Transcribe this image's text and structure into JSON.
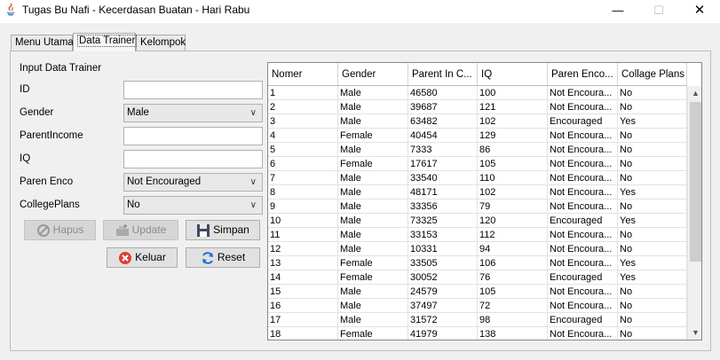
{
  "window": {
    "title": "Tugas Bu Nafi - Kecerdasan Buatan - Hari Rabu",
    "minimize": "—",
    "maximize": "☐",
    "close": "✕"
  },
  "tabs": [
    {
      "label": "Menu Utama"
    },
    {
      "label": "Data Trainer"
    },
    {
      "label": "Kelompok"
    }
  ],
  "form": {
    "heading": "Input Data Trainer",
    "id_label": "ID",
    "id_value": "",
    "gender_label": "Gender",
    "gender_value": "Male",
    "parentincome_label": "ParentIncome",
    "parentincome_value": "",
    "iq_label": "IQ",
    "iq_value": "",
    "parenenco_label": "Paren Enco",
    "parenenco_value": "Not Encouraged",
    "collegeplans_label": "CollegePlans",
    "collegeplans_value": "No"
  },
  "buttons": {
    "hapus": "Hapus",
    "update": "Update",
    "simpan": "Simpan",
    "keluar": "Keluar",
    "reset": "Reset"
  },
  "table": {
    "columns": [
      "Nomer",
      "Gender",
      "Parent In C...",
      "IQ",
      "Paren Enco...",
      "Collage Plans"
    ],
    "rows": [
      [
        "1",
        "Male",
        "46580",
        "100",
        "Not Encoura...",
        "No"
      ],
      [
        "2",
        "Male",
        "39687",
        "121",
        "Not Encoura...",
        "No"
      ],
      [
        "3",
        "Male",
        "63482",
        "102",
        "Encouraged",
        "Yes"
      ],
      [
        "4",
        "Female",
        "40454",
        "129",
        "Not Encoura...",
        "No"
      ],
      [
        "5",
        "Male",
        "7333",
        "86",
        "Not Encoura...",
        "No"
      ],
      [
        "6",
        "Female",
        "17617",
        "105",
        "Not Encoura...",
        "No"
      ],
      [
        "7",
        "Male",
        "33540",
        "110",
        "Not Encoura...",
        "No"
      ],
      [
        "8",
        "Male",
        "48171",
        "102",
        "Not Encoura...",
        "Yes"
      ],
      [
        "9",
        "Male",
        "33356",
        "79",
        "Not Encoura...",
        "No"
      ],
      [
        "10",
        "Male",
        "73325",
        "120",
        "Encouraged",
        "Yes"
      ],
      [
        "11",
        "Male",
        "33153",
        "112",
        "Not Encoura...",
        "No"
      ],
      [
        "12",
        "Male",
        "10331",
        "94",
        "Not Encoura...",
        "No"
      ],
      [
        "13",
        "Female",
        "33505",
        "106",
        "Not Encoura...",
        "Yes"
      ],
      [
        "14",
        "Female",
        "30052",
        "76",
        "Encouraged",
        "Yes"
      ],
      [
        "15",
        "Male",
        "24579",
        "105",
        "Not Encoura...",
        "No"
      ],
      [
        "16",
        "Male",
        "37497",
        "72",
        "Not Encoura...",
        "No"
      ],
      [
        "17",
        "Male",
        "31572",
        "98",
        "Encouraged",
        "No"
      ],
      [
        "18",
        "Female",
        "41979",
        "138",
        "Not Encoura...",
        "No"
      ]
    ]
  },
  "colors": {
    "disabled_text": "#8b8b8b",
    "close_icon_red": "#e03c31",
    "reset_icon_blue": "#1f6fd1"
  }
}
